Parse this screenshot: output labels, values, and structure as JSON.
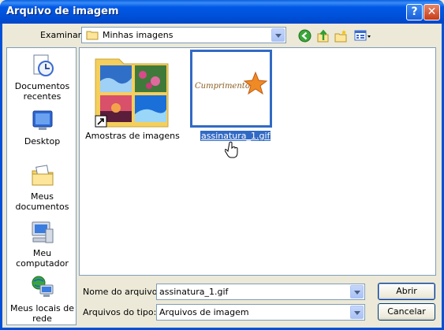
{
  "window": {
    "title": "Arquivo de imagem",
    "help_glyph": "?",
    "close_glyph": "✕"
  },
  "lookin": {
    "label": "Examinar:",
    "value": "Minhas imagens"
  },
  "toolbar": {
    "icons": [
      "back-icon",
      "up-folder-icon",
      "new-folder-icon",
      "view-menu-icon"
    ]
  },
  "places": [
    {
      "label": "Documentos recentes",
      "icon": "recent-documents-icon"
    },
    {
      "label": "Desktop",
      "icon": "desktop-icon"
    },
    {
      "label": "Meus documentos",
      "icon": "my-documents-icon"
    },
    {
      "label": "Meu computador",
      "icon": "my-computer-icon"
    },
    {
      "label": "Meus locais de rede",
      "icon": "network-places-icon"
    }
  ],
  "files": [
    {
      "name": "Amostras de imagens",
      "type": "folder-shortcut",
      "selected": false
    },
    {
      "name": "assinatura_1.gif",
      "type": "gif",
      "selected": true,
      "image_text": "Cumprimentos"
    }
  ],
  "filename": {
    "label": "Nome do arquivo:",
    "value": "assinatura_1.gif"
  },
  "filetype": {
    "label": "Arquivos do tipo:",
    "value": "Arquivos de imagem"
  },
  "buttons": {
    "open": "Abrir",
    "cancel": "Cancelar"
  },
  "colors": {
    "titlebar": "#0054e3",
    "selection": "#316ac5",
    "dialog_bg": "#ece9d8"
  }
}
